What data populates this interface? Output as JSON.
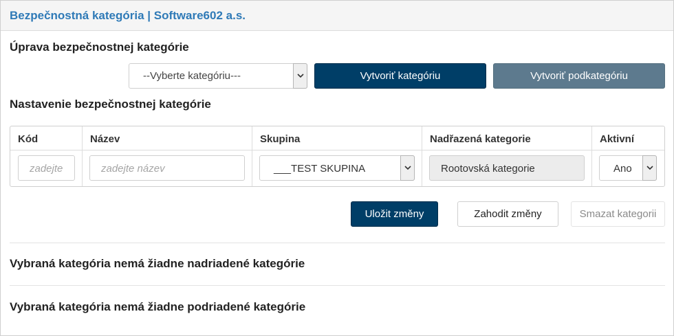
{
  "header": {
    "title": "Bezpečnostná kategória | Software602 a.s."
  },
  "edit_section": {
    "title": "Úprava bezpečnostnej kategórie",
    "category_select": {
      "value": "--Vyberte kategóriu---"
    },
    "create_category_label": "Vytvoriť kategóriu",
    "create_subcategory_label": "Vytvoriť podkategóriu"
  },
  "settings_section": {
    "title": "Nastavenie bezpečnostnej kategórie",
    "columns": {
      "code": "Kód",
      "name": "Název",
      "group": "Skupina",
      "parent": "Nadřazená kategorie",
      "active": "Aktivní"
    },
    "row": {
      "code_placeholder": "zadejte",
      "name_placeholder": "zadejte název",
      "group_value": "___TEST SKUPINA",
      "parent_value": "Rootovská kategorie",
      "active_value": "Ano"
    }
  },
  "actions": {
    "save_label": "Uložit změny",
    "discard_label": "Zahodit změny",
    "delete_label": "Smazat kategorii"
  },
  "messages": {
    "no_parents": "Vybraná kategória nemá žiadne nadriadené kategórie",
    "no_children": "Vybraná kategória nemá žiadne podriadené kategórie"
  }
}
